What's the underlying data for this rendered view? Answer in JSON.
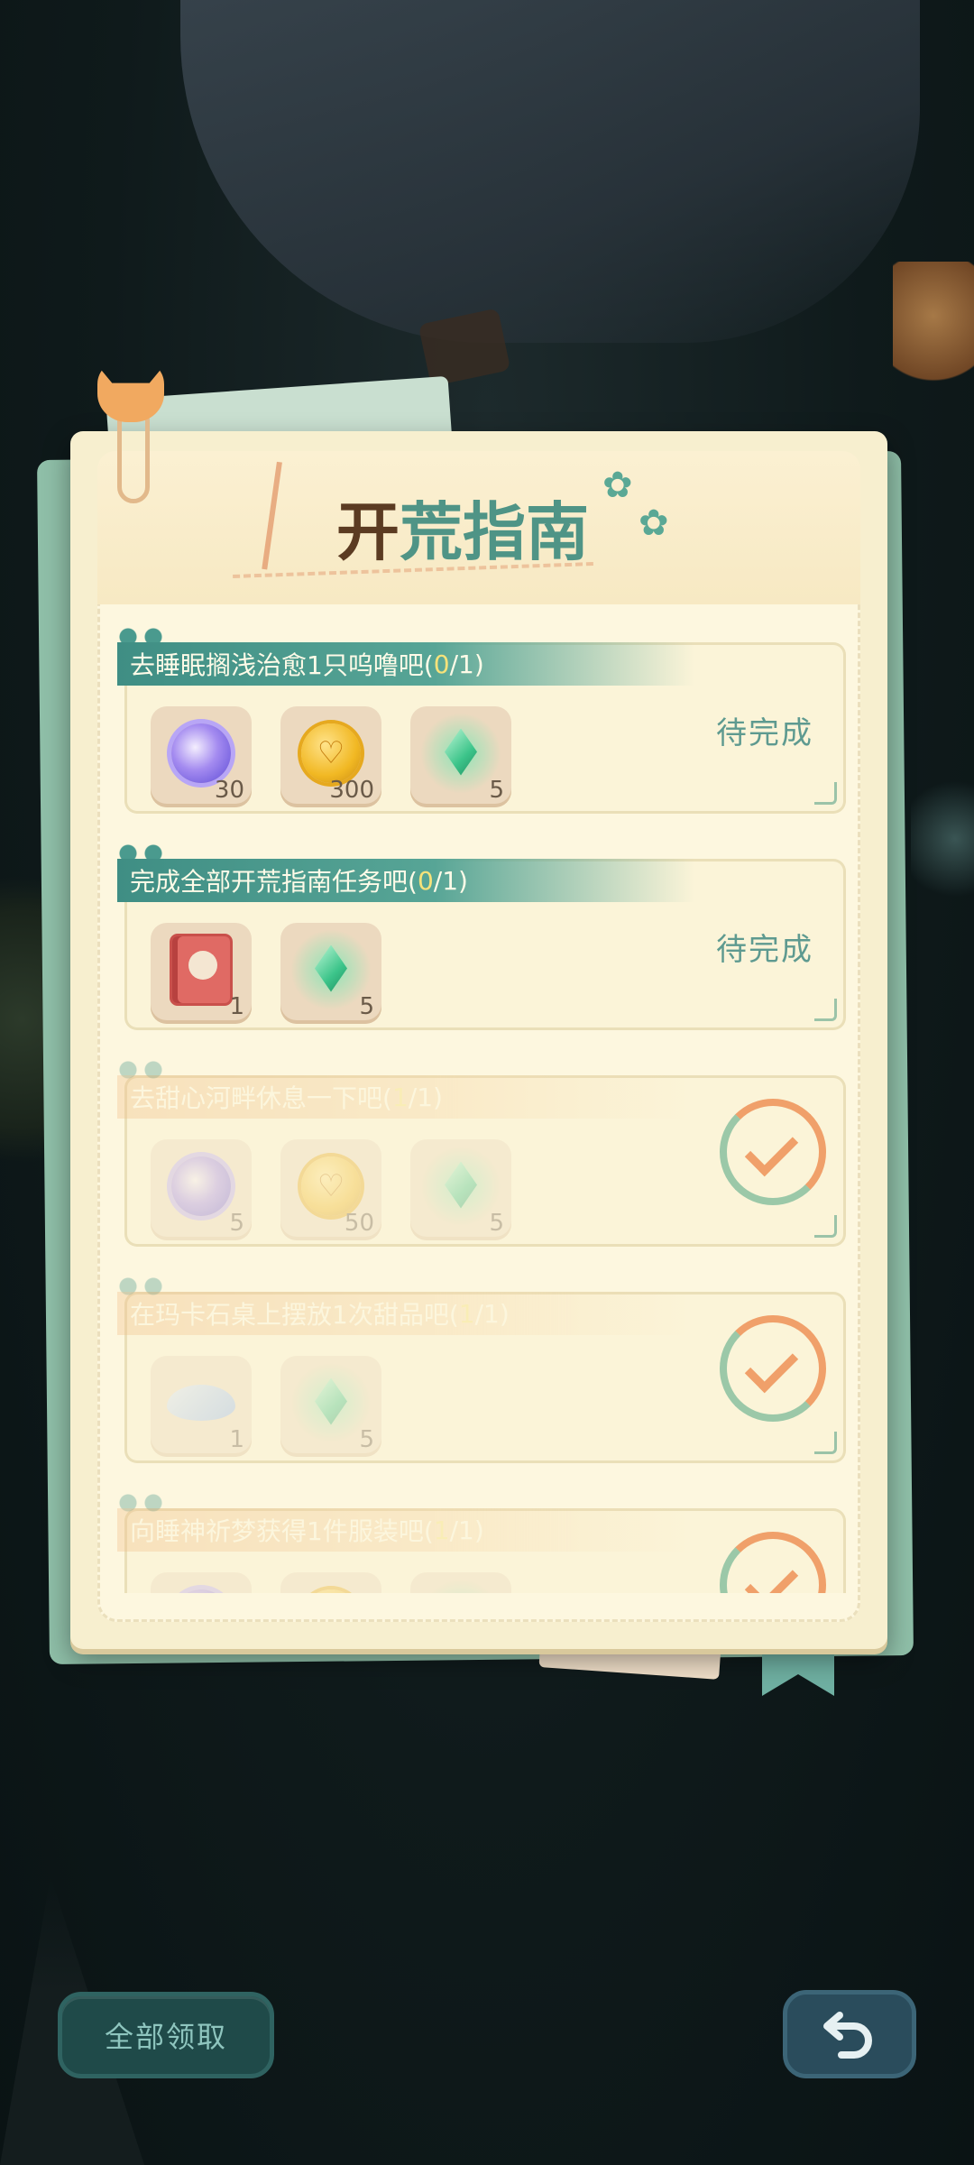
{
  "guide": {
    "title_chars": [
      "开",
      "荒",
      "指",
      "南"
    ],
    "tasks": [
      {
        "prefix": "去睡眠搁浅治愈1只呜噜吧(",
        "done_count": "0",
        "total": "/1)",
        "status": "待完成",
        "rewards": [
          {
            "icon": "purple-dream-gem-icon",
            "qty": "30"
          },
          {
            "icon": "gold-heart-coin-icon",
            "qty": "300"
          },
          {
            "icon": "green-crystal-icon",
            "qty": "5"
          }
        ]
      },
      {
        "prefix": "完成全部开荒指南任务吧(",
        "done_count": "0",
        "total": "/1)",
        "status": "待完成",
        "rewards": [
          {
            "icon": "red-book-icon",
            "qty": "1"
          },
          {
            "icon": "green-crystal-icon",
            "qty": "5"
          }
        ]
      },
      {
        "prefix": "去甜心河畔休息一下吧(",
        "done_count": "1",
        "total": "/1)",
        "status": "completed",
        "rewards": [
          {
            "icon": "purple-dream-gem-icon",
            "qty": "5"
          },
          {
            "icon": "gold-heart-coin-icon",
            "qty": "50"
          },
          {
            "icon": "green-crystal-icon",
            "qty": "5"
          }
        ]
      },
      {
        "prefix": "在玛卡石桌上摆放1次甜品吧(",
        "done_count": "1",
        "total": "/1)",
        "status": "completed",
        "rewards": [
          {
            "icon": "blue-feather-icon",
            "qty": "1"
          },
          {
            "icon": "green-crystal-icon",
            "qty": "5"
          }
        ]
      },
      {
        "prefix": "向睡神祈梦获得1件服装吧(",
        "done_count": "1",
        "total": "/1)",
        "status": "completed",
        "rewards": [
          {
            "icon": "purple-dream-gem-icon",
            "qty": ""
          },
          {
            "icon": "gold-heart-coin-icon",
            "qty": ""
          },
          {
            "icon": "green-crystal-icon",
            "qty": ""
          }
        ]
      }
    ]
  },
  "buttons": {
    "claim_all": "全部领取",
    "back_icon": "return-arrow-icon"
  },
  "colors": {
    "banner_teal": "#3f8e84",
    "progress_yellow": "#f6e27a",
    "pending_text": "#5e9a90",
    "check_orange": "#f0a06a"
  }
}
